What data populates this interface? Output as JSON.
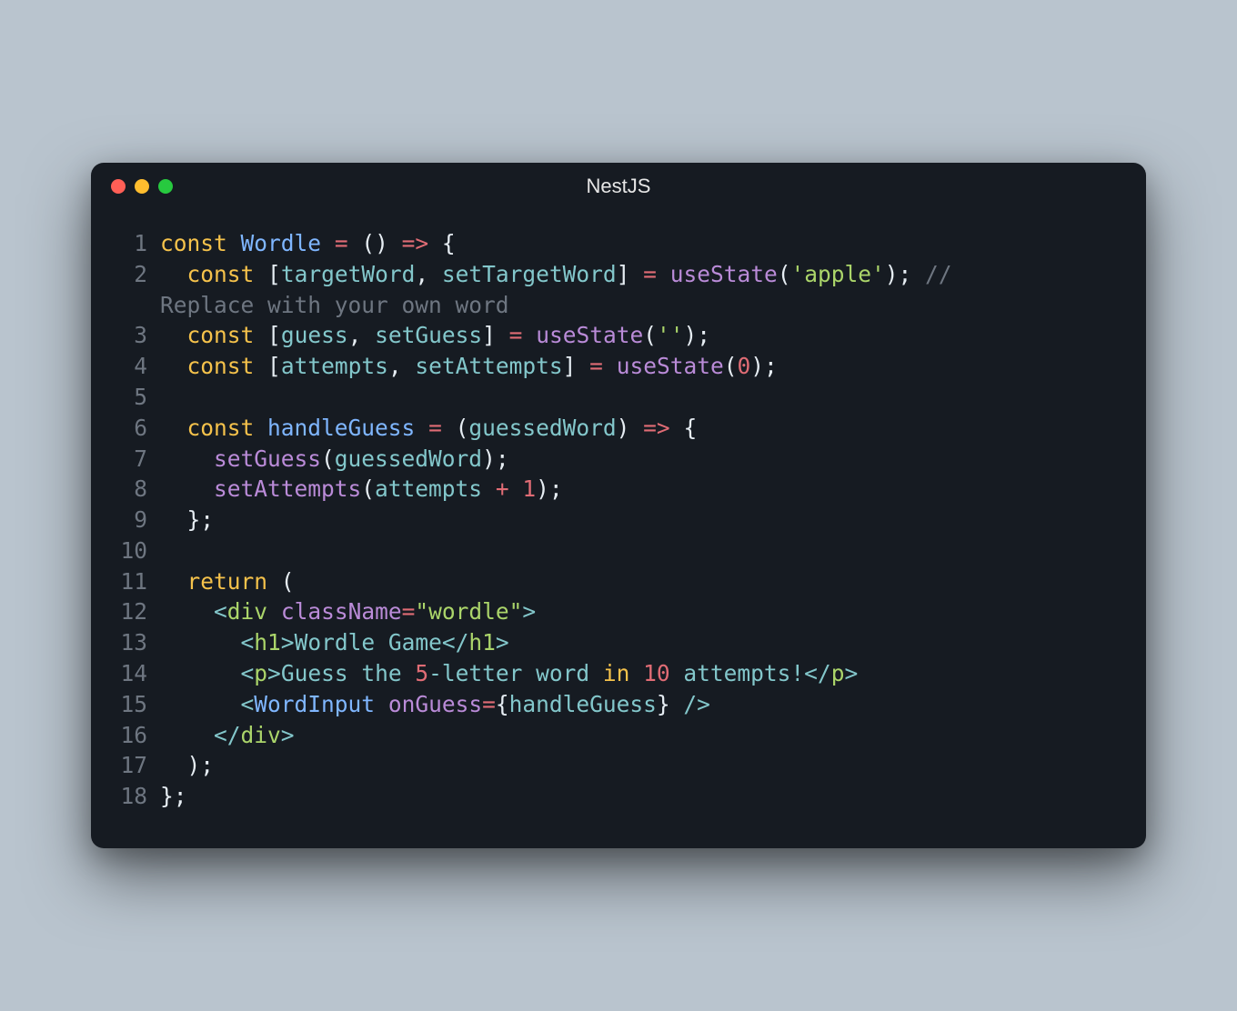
{
  "window": {
    "title": "NestJS"
  },
  "traffic": {
    "red": "#ff5f56",
    "yellow": "#ffbd2e",
    "green": "#27c93f"
  },
  "code": {
    "t": {
      "const": "const",
      "return": "return",
      "in": "in",
      "arrow": "=>",
      "eq": "=",
      "plus": "+"
    },
    "id": {
      "Wordle": "Wordle",
      "targetWord": "targetWord",
      "setTargetWord": "setTargetWord",
      "guess": "guess",
      "setGuess": "setGuess",
      "attempts": "attempts",
      "setAttempts": "setAttempts",
      "handleGuess": "handleGuess",
      "guessedWord": "guessedWord",
      "useState": "useState",
      "WordInput": "WordInput",
      "onGuess": "onGuess",
      "className": "className",
      "div": "div",
      "h1": "h1",
      "p": "p"
    },
    "str": {
      "apple": "'apple'",
      "empty": "''",
      "wordle": "\"wordle\""
    },
    "num": {
      "zero": "0",
      "one": "1",
      "five": "5",
      "ten": "10"
    },
    "cmt": {
      "part1": "//",
      "part2": "Replace with your own word"
    },
    "txt": {
      "h1": "Wordle Game",
      "p1": "Guess the ",
      "p2": "-letter word ",
      "p3": " attempts!"
    },
    "lineNumbers": [
      "1",
      "2",
      "3",
      "4",
      "5",
      "6",
      "7",
      "8",
      "9",
      "10",
      "11",
      "12",
      "13",
      "14",
      "15",
      "16",
      "17",
      "18"
    ]
  }
}
